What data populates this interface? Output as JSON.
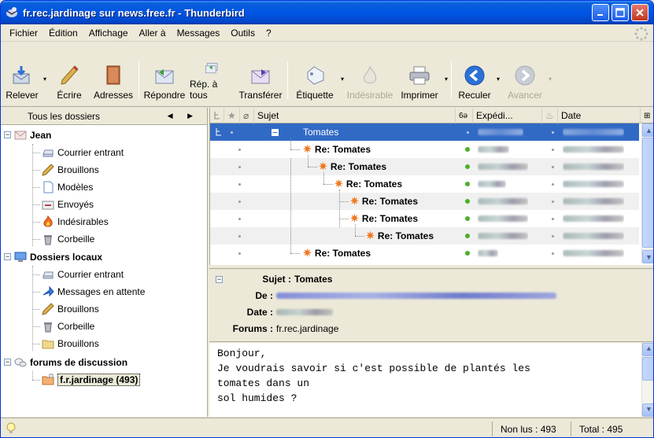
{
  "window": {
    "title": "fr.rec.jardinage sur news.free.fr - Thunderbird",
    "controls": {
      "minimize": "minimize",
      "maximize": "maximize",
      "close": "close"
    }
  },
  "menu": [
    {
      "label": "Fichier"
    },
    {
      "label": "Édition"
    },
    {
      "label": "Affichage"
    },
    {
      "label": "Aller à"
    },
    {
      "label": "Messages"
    },
    {
      "label": "Outils"
    },
    {
      "label": "?"
    }
  ],
  "toolbar": {
    "get": "Relever",
    "write": "Écrire",
    "addresses": "Adresses",
    "reply": "Répondre",
    "reply_all": "Rép. à tous",
    "forward": "Transférer",
    "tag": "Étiquette",
    "junk": "Indésirable",
    "print": "Imprimer",
    "back": "Reculer",
    "forward_nav": "Avancer"
  },
  "folders": {
    "header": "Tous les dossiers",
    "jean": {
      "label": "Jean",
      "items": [
        "Courrier entrant",
        "Brouillons",
        "Modèles",
        "Envoyés",
        "Indésirables",
        "Corbeille"
      ]
    },
    "local": {
      "label": "Dossiers locaux",
      "items": [
        "Courrier entrant",
        "Messages en attente",
        "Brouillons",
        "Corbeille",
        "Brouillons"
      ]
    },
    "news": {
      "label": "forums de discussion",
      "group": "f.r.jardinage (493)"
    }
  },
  "thread": {
    "columns": {
      "subject": "Sujet",
      "sender": "Expédi...",
      "date": "Date"
    },
    "rows": [
      {
        "subject": "Tomates",
        "level": 0
      },
      {
        "subject": "Re: Tomates",
        "level": 1
      },
      {
        "subject": "Re: Tomates",
        "level": 2
      },
      {
        "subject": "Re: Tomates",
        "level": 3
      },
      {
        "subject": "Re: Tomates",
        "level": 4
      },
      {
        "subject": "Re: Tomates",
        "level": 4
      },
      {
        "subject": "Re: Tomates",
        "level": 5
      },
      {
        "subject": "Re: Tomates",
        "level": 1
      }
    ]
  },
  "message_header": {
    "subject_key": "Sujet :",
    "subject_value": "Tomates",
    "from_key": "De :",
    "date_key": "Date :",
    "forums_key": "Forums :",
    "forums_value": "fr.rec.jardinage"
  },
  "message_body": [
    "Bonjour,",
    "Je voudrais savoir si c'est possible de plantés les",
    "tomates dans un",
    "sol humides ?"
  ],
  "status": {
    "unread": "Non lus : 493",
    "total": "Total : 495"
  }
}
